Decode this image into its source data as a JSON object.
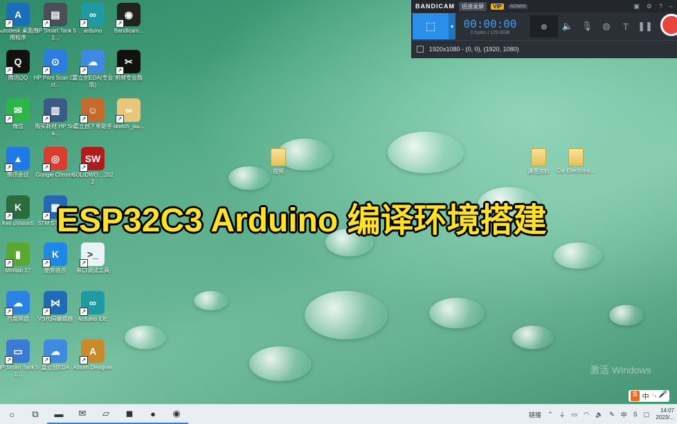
{
  "desktop_icons": [
    {
      "label": "Autodesk 桌面应用程序",
      "icon": "autodesk-icon",
      "color": "#1b6fb8",
      "glyph": "A"
    },
    {
      "label": "HP Smart Tank 51...",
      "icon": "printer-icon",
      "color": "#4a4f57",
      "glyph": "▤"
    },
    {
      "label": "arduino",
      "icon": "arduino-icon",
      "color": "#1f9aa3",
      "glyph": "∞"
    },
    {
      "label": "Bandicam...",
      "icon": "bandicam-icon",
      "color": "#222222",
      "glyph": "◉"
    },
    {
      "label": "腾讯QQ",
      "icon": "qq-icon",
      "color": "#111111",
      "glyph": "Q"
    },
    {
      "label": "HP Print Scan Doct...",
      "icon": "hp-scan-icon",
      "color": "#2b7de0",
      "glyph": "⊙"
    },
    {
      "label": "嘉立创EDA(专业版)",
      "icon": "easyeda-pro-icon",
      "color": "#3f8ae0",
      "glyph": "☁"
    },
    {
      "label": "剪映专业版",
      "icon": "capcut-icon",
      "color": "#111111",
      "glyph": "✂"
    },
    {
      "label": "微信",
      "icon": "wechat-icon",
      "color": "#2fb44a",
      "glyph": "✉"
    },
    {
      "label": "购买耗材 HP Sma...",
      "icon": "hp-supplies-icon",
      "color": "#3c5a86",
      "glyph": "▥"
    },
    {
      "label": "嘉立创下单助手",
      "icon": "jlc-helper-icon",
      "color": "#c56a2a",
      "glyph": "☺"
    },
    {
      "label": "sketch_jau...",
      "icon": "sketch-file-icon",
      "color": "#e8c77a",
      "glyph": "∞"
    },
    {
      "label": "腾讯会议",
      "icon": "tencent-meeting-icon",
      "color": "#1f7ae8",
      "glyph": "▲"
    },
    {
      "label": "Google Chrome",
      "icon": "chrome-icon",
      "color": "#d93d2f",
      "glyph": "◎"
    },
    {
      "label": "SOLIDWO... 2022",
      "icon": "solidworks-icon",
      "color": "#b01c1c",
      "glyph": "SW"
    },
    {
      "label": "Keil uVision5",
      "icon": "keil-icon",
      "color": "#2c6b3b",
      "glyph": "K"
    },
    {
      "label": "STM STM32...",
      "icon": "stm32-icon",
      "color": "#2467b3",
      "glyph": "▦"
    },
    {
      "label": "Minitab 17",
      "icon": "minitab-icon",
      "color": "#5aa832",
      "glyph": "▮"
    },
    {
      "label": "酷狗音乐",
      "icon": "kugou-icon",
      "color": "#1f87e8",
      "glyph": "K"
    },
    {
      "label": "串口调试工具",
      "icon": "serial-tool-icon",
      "color": "#e9f2f5",
      "glyph": ">_"
    },
    {
      "label": "百度网盘",
      "icon": "baidu-netdisk-icon",
      "color": "#2a82e4",
      "glyph": "☁"
    },
    {
      "label": "VS代码编辑器",
      "icon": "vscode-icon",
      "color": "#1f6bb5",
      "glyph": "⋈"
    },
    {
      "label": "Arduino IDE",
      "icon": "arduino-ide-icon",
      "color": "#1f9aa3",
      "glyph": "∞"
    },
    {
      "label": "HP Smart Tank 51...",
      "icon": "hp-smart-icon",
      "color": "#3a7bd5",
      "glyph": "▭"
    },
    {
      "label": "嘉立创EDA",
      "icon": "easyeda-icon",
      "color": "#3f8ae0",
      "glyph": "☁"
    },
    {
      "label": "Altium Designer",
      "icon": "altium-icon",
      "color": "#c98a2a",
      "glyph": "A"
    }
  ],
  "folders": [
    {
      "label": "视频",
      "icon": "folder-icon"
    },
    {
      "label": "课题资料",
      "icon": "folder-icon"
    },
    {
      "label": "Car Electronic...",
      "icon": "folder-icon"
    }
  ],
  "title_overlay": "ESP32C3 Arduino 编译环境搭建",
  "bandicam": {
    "logo": "BANDICAM",
    "record_tag": "班迪录屏",
    "vip": "VIP",
    "admin": "ADMIN",
    "timer": "00:00:00",
    "size": "0 bytes / 129.8GB",
    "region": "1920x1080 - (0, 0), (1920, 1080)"
  },
  "watermark": "激活 Windows",
  "taskbar": {
    "apps": [
      {
        "icon": "search-icon",
        "glyph": "○"
      },
      {
        "icon": "task-view-icon",
        "glyph": "⧉"
      },
      {
        "icon": "file-explorer-icon",
        "glyph": "▬"
      },
      {
        "icon": "mail-icon",
        "glyph": "✉"
      },
      {
        "icon": "photos-icon",
        "glyph": "▱"
      },
      {
        "icon": "capcut-taskbar-icon",
        "glyph": "◼"
      },
      {
        "icon": "wechat-taskbar-icon",
        "glyph": "●"
      },
      {
        "icon": "bandicam-taskbar-icon",
        "glyph": "◉"
      }
    ],
    "tray_link": "链接",
    "ime_lang": "中",
    "time": "14:07",
    "date": "2023/..."
  },
  "colors": {
    "title_yellow": "#ffe12a",
    "bandicam_blue": "#2a8fe8",
    "record_red": "#e8453c"
  }
}
